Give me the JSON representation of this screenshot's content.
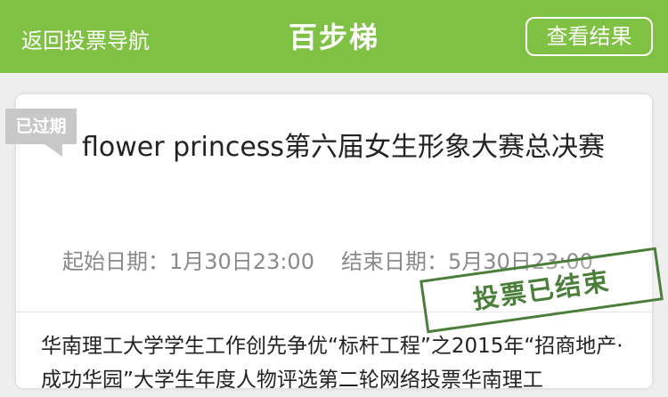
{
  "header": {
    "back_label": "返回投票导航",
    "logo_text": "百步梯",
    "result_button_label": "查看结果",
    "bg_color": "#7fc142"
  },
  "vote": {
    "status_tag": "已过期",
    "title": "flower princess第六届女生形象大赛总决赛",
    "start_label": "起始日期：",
    "start_date": "1月30日23:00",
    "end_label": "结束日期：",
    "end_date": "5月30日23:00",
    "stamp_text": "投票已结束",
    "stamp_color": "#4a7f3a",
    "description": "华南理工大学学生工作创先争优“标杆工程”之2015年“招商地产·成功华园”大学生年度人物评选第二轮网络投票华南理工"
  }
}
